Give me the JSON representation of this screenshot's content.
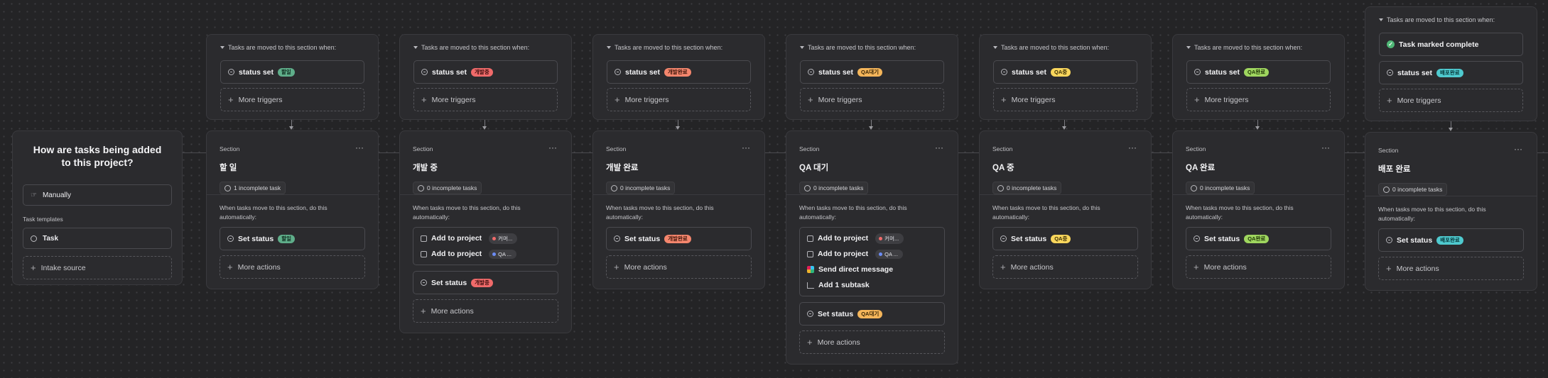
{
  "intake": {
    "question": "How are tasks being added to this project?",
    "manual_label": "Manually",
    "templates_label": "Task templates",
    "template_task": "Task",
    "intake_source": "Intake source"
  },
  "labels": {
    "trigger_head": "Tasks are moved to this section when:",
    "status_set": "status set",
    "more_triggers": "More triggers",
    "section_kicker": "Section",
    "more_dots": "···",
    "when_move": "When tasks move to this section, do this automatically:",
    "set_status": "Set status",
    "add_to_project": "Add to project",
    "send_dm": "Send direct message",
    "add_subtask": "Add 1 subtask",
    "more_actions": "More actions",
    "task_marked_complete": "Task marked complete"
  },
  "projects": {
    "project_a": "커머...",
    "project_b": "QA ..."
  },
  "colors": {
    "pill_todo_bg": "#5fae8a",
    "pill_doing_bg": "#f06a6a",
    "pill_done_bg": "#f4866d",
    "pill_qa_wait_bg": "#f4b55a",
    "pill_qa_doing_bg": "#f9d65c",
    "pill_qa_done_bg": "#9fd65f",
    "pill_deploy_bg": "#4fcacf",
    "proj_dot_a": "#f06a6a",
    "proj_dot_b": "#6c8cf5",
    "check_green": "#4fb776"
  },
  "columns": [
    {
      "status": "할일",
      "title": "할 일",
      "count": "1 incomplete task"
    },
    {
      "status": "개발중",
      "title": "개발 중",
      "count": "0 incomplete tasks"
    },
    {
      "status": "개발완료",
      "title": "개발 완료",
      "count": "0 incomplete tasks"
    },
    {
      "status": "QA대기",
      "title": "QA 대기",
      "count": "0 incomplete tasks"
    },
    {
      "status": "QA중",
      "title": "QA 중",
      "count": "0 incomplete tasks"
    },
    {
      "status": "QA완료",
      "title": "QA 완료",
      "count": "0 incomplete tasks"
    },
    {
      "status": "배포완료",
      "title": "배포 완료",
      "count": "0 incomplete tasks"
    }
  ]
}
